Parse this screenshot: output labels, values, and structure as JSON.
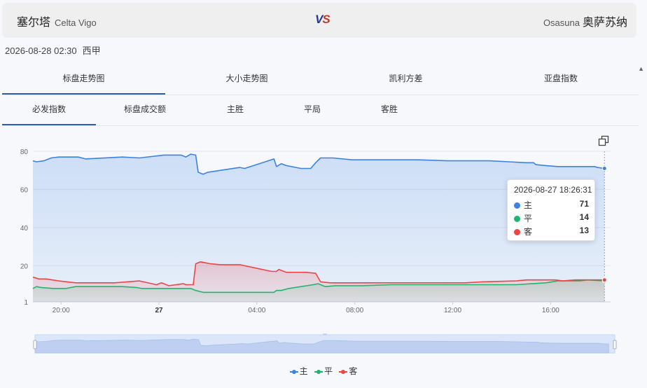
{
  "match": {
    "home_cn": "塞尔塔",
    "home_en": "Celta Vigo",
    "away_en": "Osasuna",
    "away_cn": "奥萨苏纳",
    "vs_v": "V",
    "vs_s": "S",
    "datetime": "2026-08-28 02:30",
    "league": "西甲"
  },
  "tabs_primary": [
    "标盘走势图",
    "大小走势图",
    "凯利方差",
    "亚盘指数"
  ],
  "tabs_secondary": [
    "必发指数",
    "标盘成交额",
    "主胜",
    "平局",
    "客胜"
  ],
  "icons": {
    "copy": "copy-icon",
    "collapse": "caret-up-icon"
  },
  "colors": {
    "home": "#3b82e6",
    "draw": "#1fb56e",
    "away": "#ee4444",
    "accent": "#2c5bb8"
  },
  "tooltip": {
    "time": "2026-08-27 18:26:31",
    "rows": [
      {
        "label": "主",
        "value": "71"
      },
      {
        "label": "平",
        "value": "14"
      },
      {
        "label": "客",
        "value": "13"
      }
    ]
  },
  "chart_data": {
    "type": "line",
    "y_ticks": [
      "80",
      "60",
      "40",
      "20",
      "1"
    ],
    "x_ticks": [
      {
        "label": "20:00",
        "t": 20.0
      },
      {
        "label": "27",
        "t": 24.0
      },
      {
        "label": "04:00",
        "t": 28.0
      },
      {
        "label": "08:00",
        "t": 32.0
      },
      {
        "label": "12:00",
        "t": 36.0
      },
      {
        "label": "16:00",
        "t": 40.0
      }
    ],
    "xlim": [
      18.85,
      42.45
    ],
    "ylim": [
      1,
      80
    ],
    "grid": true,
    "legend": "bottom-center",
    "series": [
      {
        "name": "主",
        "color": "#3b82e6",
        "points": [
          [
            18.85,
            75
          ],
          [
            19.0,
            74.5
          ],
          [
            19.3,
            75
          ],
          [
            19.6,
            76.5
          ],
          [
            19.9,
            77
          ],
          [
            20.7,
            77
          ],
          [
            21.0,
            76
          ],
          [
            22.5,
            77
          ],
          [
            23.2,
            76.5
          ],
          [
            24.2,
            78
          ],
          [
            24.9,
            78
          ],
          [
            25.1,
            77
          ],
          [
            25.3,
            78.5
          ],
          [
            25.5,
            78
          ],
          [
            25.6,
            69
          ],
          [
            25.8,
            68
          ],
          [
            26.0,
            69
          ],
          [
            27.3,
            71.5
          ],
          [
            27.5,
            71
          ],
          [
            28.7,
            76
          ],
          [
            28.8,
            72
          ],
          [
            29.0,
            73.5
          ],
          [
            29.2,
            72.5
          ],
          [
            29.8,
            71
          ],
          [
            30.2,
            71
          ],
          [
            30.4,
            74
          ],
          [
            30.6,
            76.5
          ],
          [
            31.1,
            76.5
          ],
          [
            31.9,
            75.5
          ],
          [
            32.5,
            75.5
          ],
          [
            34.6,
            75.5
          ],
          [
            35.8,
            75
          ],
          [
            37.5,
            75
          ],
          [
            38.3,
            74.5
          ],
          [
            39.0,
            74
          ],
          [
            39.3,
            74
          ],
          [
            39.4,
            73
          ],
          [
            39.8,
            72.5
          ],
          [
            40.3,
            72
          ],
          [
            41.8,
            72
          ],
          [
            41.9,
            71.5
          ],
          [
            42.2,
            71
          ]
        ]
      },
      {
        "name": "平",
        "color": "#1fb56e",
        "points": [
          [
            18.85,
            8
          ],
          [
            19.0,
            9
          ],
          [
            19.2,
            8.5
          ],
          [
            19.7,
            8
          ],
          [
            20.2,
            8
          ],
          [
            20.6,
            9
          ],
          [
            22.5,
            9
          ],
          [
            23.1,
            8.5
          ],
          [
            23.3,
            8
          ],
          [
            25.3,
            8
          ],
          [
            25.5,
            7
          ],
          [
            25.8,
            6
          ],
          [
            26.5,
            6
          ],
          [
            28.7,
            6
          ],
          [
            28.8,
            7
          ],
          [
            29.0,
            7
          ],
          [
            29.3,
            8
          ],
          [
            30.3,
            10
          ],
          [
            30.5,
            10.5
          ],
          [
            30.8,
            9
          ],
          [
            31.2,
            9.5
          ],
          [
            32.3,
            9.5
          ],
          [
            33.5,
            10
          ],
          [
            35.0,
            10
          ],
          [
            37.9,
            10
          ],
          [
            38.6,
            10
          ],
          [
            39.8,
            11
          ],
          [
            40.3,
            12
          ],
          [
            41.2,
            12
          ],
          [
            41.5,
            12.5
          ],
          [
            42.2,
            12
          ]
        ]
      },
      {
        "name": "客",
        "color": "#ee4444",
        "points": [
          [
            18.85,
            14
          ],
          [
            19.1,
            13
          ],
          [
            19.4,
            13
          ],
          [
            19.9,
            12
          ],
          [
            20.6,
            11
          ],
          [
            22.2,
            11
          ],
          [
            23.2,
            12
          ],
          [
            23.9,
            10
          ],
          [
            24.1,
            11
          ],
          [
            24.4,
            9.5
          ],
          [
            24.7,
            10
          ],
          [
            25.0,
            10.5
          ],
          [
            25.1,
            10
          ],
          [
            25.4,
            10
          ],
          [
            25.5,
            21
          ],
          [
            25.7,
            22
          ],
          [
            26.1,
            21
          ],
          [
            26.5,
            20.5
          ],
          [
            27.3,
            20.5
          ],
          [
            28.6,
            17
          ],
          [
            28.8,
            17
          ],
          [
            28.9,
            18
          ],
          [
            29.0,
            17.5
          ],
          [
            29.2,
            16.5
          ],
          [
            30.0,
            16.5
          ],
          [
            30.4,
            16
          ],
          [
            30.6,
            11.5
          ],
          [
            31.0,
            11
          ],
          [
            36.5,
            11
          ],
          [
            37.2,
            11.5
          ],
          [
            38.6,
            12
          ],
          [
            39.0,
            12.5
          ],
          [
            40.2,
            12.5
          ],
          [
            40.5,
            12
          ],
          [
            41.0,
            12.5
          ],
          [
            42.2,
            12.5
          ]
        ]
      }
    ]
  }
}
